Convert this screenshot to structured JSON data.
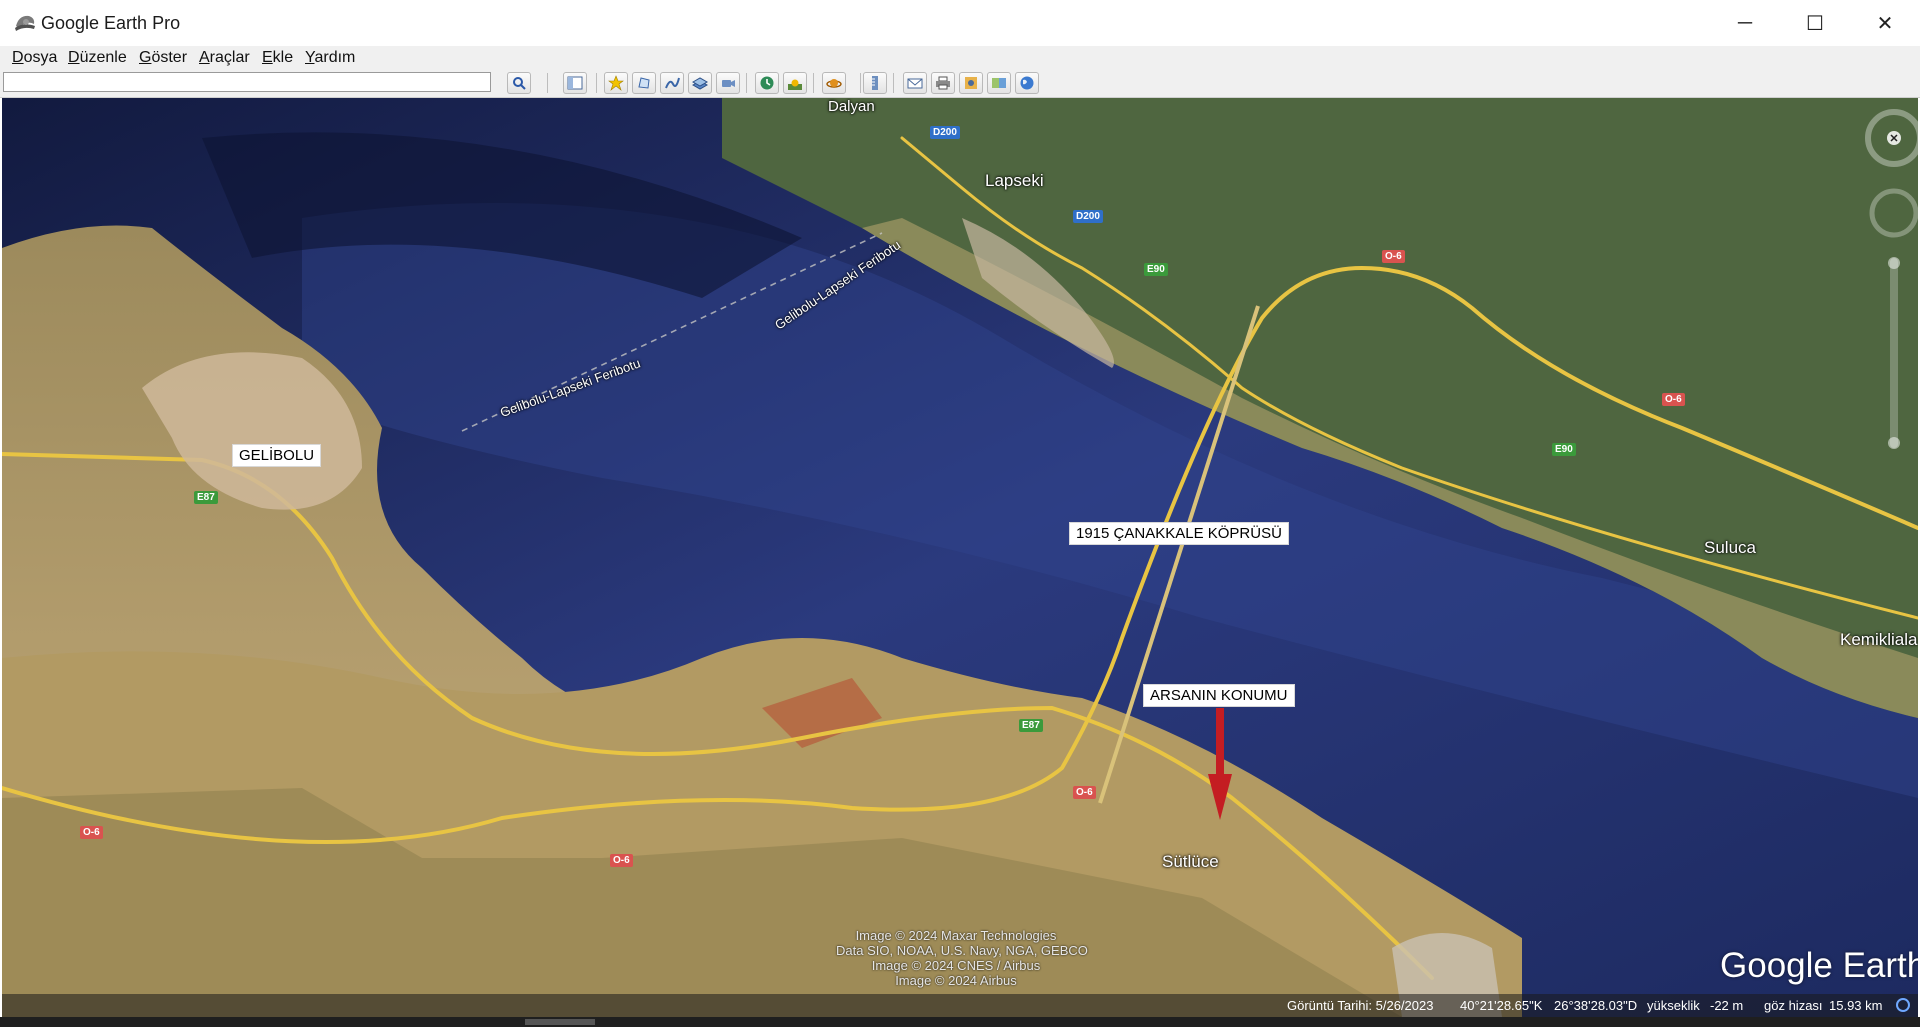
{
  "window": {
    "title": "Google Earth Pro",
    "controls": {
      "minimize": "─",
      "maximize": "☐",
      "close": "✕"
    }
  },
  "menu": [
    {
      "accel": "D",
      "rest": "osya"
    },
    {
      "accel": "D",
      "rest": "üzenle"
    },
    {
      "accel": "G",
      "rest": "öster"
    },
    {
      "accel": "A",
      "rest": "raçlar"
    },
    {
      "accel": "E",
      "rest": "kle"
    },
    {
      "accel": "Y",
      "rest": "ardım"
    }
  ],
  "search": {
    "value": "",
    "placeholder": ""
  },
  "toolbar": {
    "icons": [
      "search-icon",
      "sidebar-toggle-icon",
      "add-placemark-icon",
      "add-polygon-icon",
      "add-path-icon",
      "add-image-overlay-icon",
      "record-tour-icon",
      "historical-imagery-icon",
      "sunlight-icon",
      "switch-planet-icon",
      "ruler-icon",
      "email-icon",
      "print-icon",
      "save-image-icon",
      "view-in-maps-icon",
      "earth-icon"
    ]
  },
  "map": {
    "places": {
      "dalyan": "Dalyan",
      "lapseki": "Lapseki",
      "suluca": "Suluca",
      "kemiklialan": "Kemikliala",
      "sutluce": "Sütlüce",
      "ferry_1": "Gelibolu-Lapseki Feribotu",
      "ferry_2": "Gelibolu-Lapseki Feribotu"
    },
    "placemarks": {
      "gelibolu": "GELİBOLU",
      "bridge": "1915 ÇANAKKALE KÖPRÜSÜ",
      "plot": "ARSANIN KONUMU"
    },
    "shields": {
      "d200_a": "D200",
      "d200_b": "D200",
      "e90_a": "E90",
      "e90_b": "E90",
      "e87_a": "E87",
      "e87_b": "E87",
      "o6_a": "O-6",
      "o6_b": "O-6",
      "o6_c": "O-6",
      "o6_d": "O-6",
      "o6_e": "O-6"
    },
    "credits": [
      "Image © 2024 Maxar Technologies",
      "Data SIO, NOAA, U.S. Navy, NGA, GEBCO",
      "Image © 2024 CNES / Airbus",
      "Image © 2024 Airbus"
    ],
    "logo": "Google Earth"
  },
  "status": {
    "imagery_date": "Görüntü Tarihi: 5/26/2023",
    "lat": "40°21'28.65\"K",
    "lon": "26°38'28.03\"D",
    "elev_label": "yükseklik",
    "elev": "-22 m",
    "eye_label": "göz hizası",
    "eye": "15.93 km"
  },
  "colors": {
    "sea_deep": "#1a2350",
    "sea": "#2b3a7e",
    "land": "#b39a66",
    "land_green": "#4f6640",
    "road": "#e8c443",
    "arrow": "#c41d22"
  }
}
